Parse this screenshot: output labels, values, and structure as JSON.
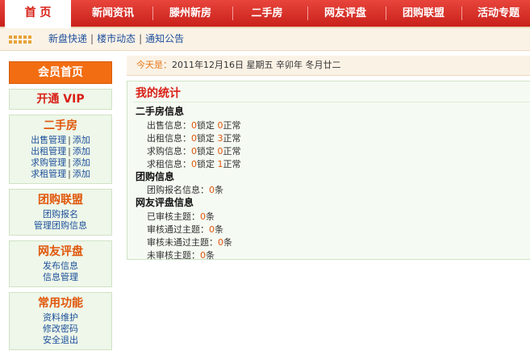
{
  "nav": {
    "home": "首  页",
    "items": [
      "新闻资讯",
      "滕州新房",
      "二手房",
      "网友评盘",
      "团购联盟",
      "活动专题"
    ]
  },
  "subnav": {
    "links": [
      "新盘快递",
      "楼市动态",
      "通知公告"
    ],
    "separator": "|"
  },
  "sidebar": {
    "member_home": "会员首页",
    "vip": "开通 VIP",
    "second_hand": {
      "title": "二手房",
      "rows": [
        {
          "manage": "出售管理",
          "add": "添加"
        },
        {
          "manage": "出租管理",
          "add": "添加"
        },
        {
          "manage": "求购管理",
          "add": "添加"
        },
        {
          "manage": "求租管理",
          "add": "添加"
        }
      ]
    },
    "group_buy": {
      "title": "团购联盟",
      "items": [
        "团购报名",
        "管理团购信息"
      ]
    },
    "review": {
      "title": "网友评盘",
      "items": [
        "发布信息",
        "信息管理"
      ]
    },
    "common": {
      "title": "常用功能",
      "items": [
        "资料维护",
        "修改密码",
        "安全退出"
      ]
    },
    "bar": "|"
  },
  "date": {
    "label": "今天是：",
    "value": "2011年12月16日 星期五 辛卯年 冬月廿二"
  },
  "stats": {
    "title": "我的统计",
    "second_hand": {
      "title": "二手房信息",
      "rows": [
        {
          "label": "出售信息：",
          "locked": "0",
          "locked_text": "锁定",
          "normal": "0",
          "normal_text": "正常"
        },
        {
          "label": "出租信息：",
          "locked": "0",
          "locked_text": "锁定",
          "normal": "3",
          "normal_text": "正常"
        },
        {
          "label": "求购信息：",
          "locked": "0",
          "locked_text": "锁定",
          "normal": "0",
          "normal_text": "正常"
        },
        {
          "label": "求租信息：",
          "locked": "0",
          "locked_text": "锁定",
          "normal": "1",
          "normal_text": "正常"
        }
      ]
    },
    "group": {
      "title": "团购信息",
      "rows": [
        {
          "label": "团购报名信息：",
          "value": "0",
          "unit": "条"
        }
      ]
    },
    "review": {
      "title": "网友评盘信息",
      "rows": [
        {
          "label": "已审核主题：",
          "value": "0",
          "unit": "条"
        },
        {
          "label": "审核通过主题：",
          "value": "0",
          "unit": "条"
        },
        {
          "label": "审核未通过主题：",
          "value": "0",
          "unit": "条"
        },
        {
          "label": "未审核主题：",
          "value": "0",
          "unit": "条"
        }
      ]
    }
  }
}
